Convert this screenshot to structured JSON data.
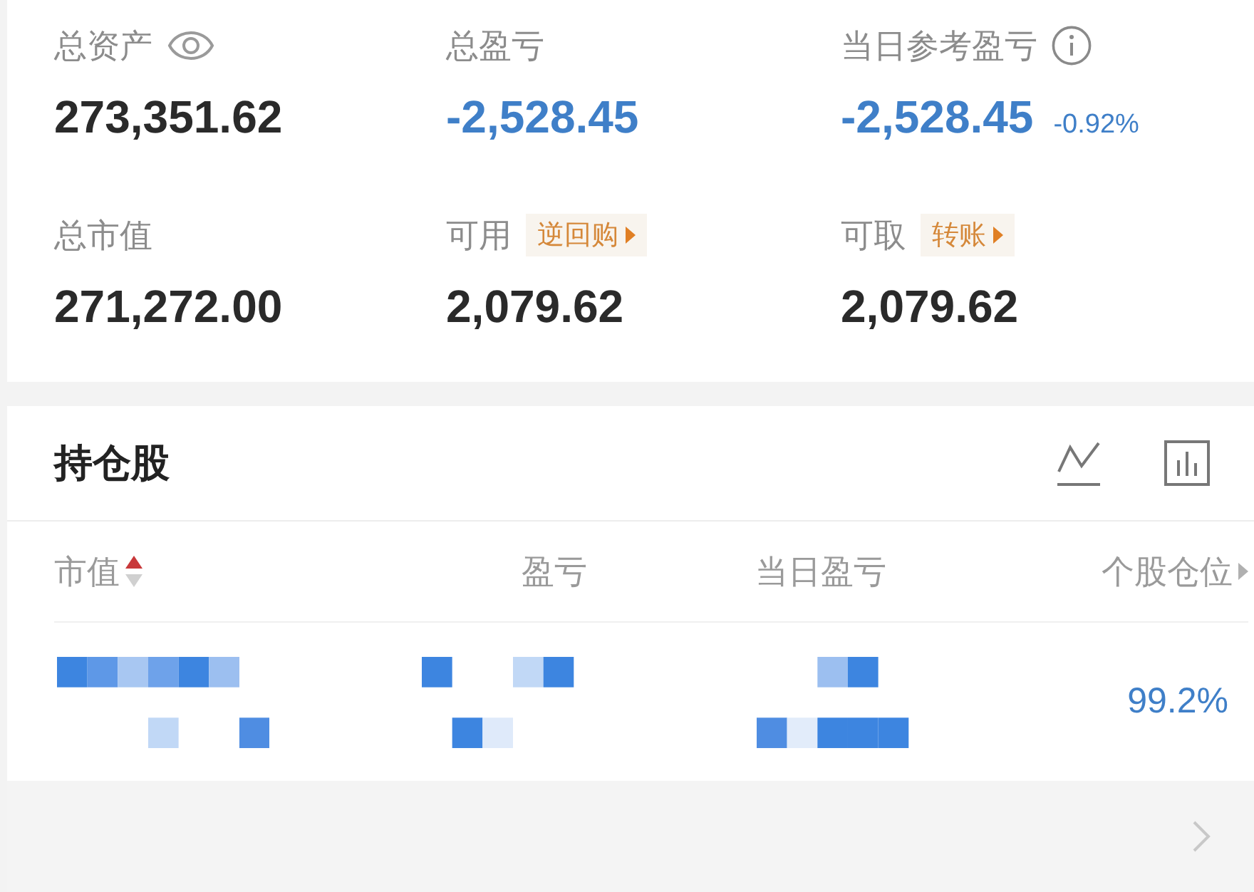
{
  "summary": {
    "items": [
      {
        "label": "总资产",
        "kind": "toggle",
        "value": "273,351.62",
        "loss": false
      },
      {
        "label": "总盈亏",
        "kind": "plain",
        "value": "-2,528.45",
        "loss": true
      },
      {
        "label": "当日参考盈亏",
        "kind": "info",
        "value": "-2,528.45",
        "change": "-0.92%",
        "loss": true
      },
      {
        "label": "总市值",
        "kind": "plain",
        "value": "271,272.00",
        "loss": false
      },
      {
        "label": "可用",
        "kind": "link",
        "link": "逆回购",
        "value": "2,079.62",
        "loss": false
      },
      {
        "label": "可取",
        "kind": "link",
        "link": "转账",
        "value": "2,079.62",
        "loss": false
      }
    ]
  },
  "holdings": {
    "title": "持仓股",
    "columns": [
      {
        "label": "市值",
        "sort_ascending": true,
        "more": false
      },
      {
        "label": "盈亏",
        "more": false
      },
      {
        "label": "当日盈亏",
        "more": false
      },
      {
        "label": "个股仓位",
        "more": true
      }
    ],
    "rows": [
      {
        "cells": [
          {
            "kind": "pixelated"
          },
          {
            "kind": "pixelated"
          },
          {
            "kind": "pixelated"
          },
          {
            "kind": "text",
            "text": "99.2%"
          }
        ]
      }
    ]
  }
}
